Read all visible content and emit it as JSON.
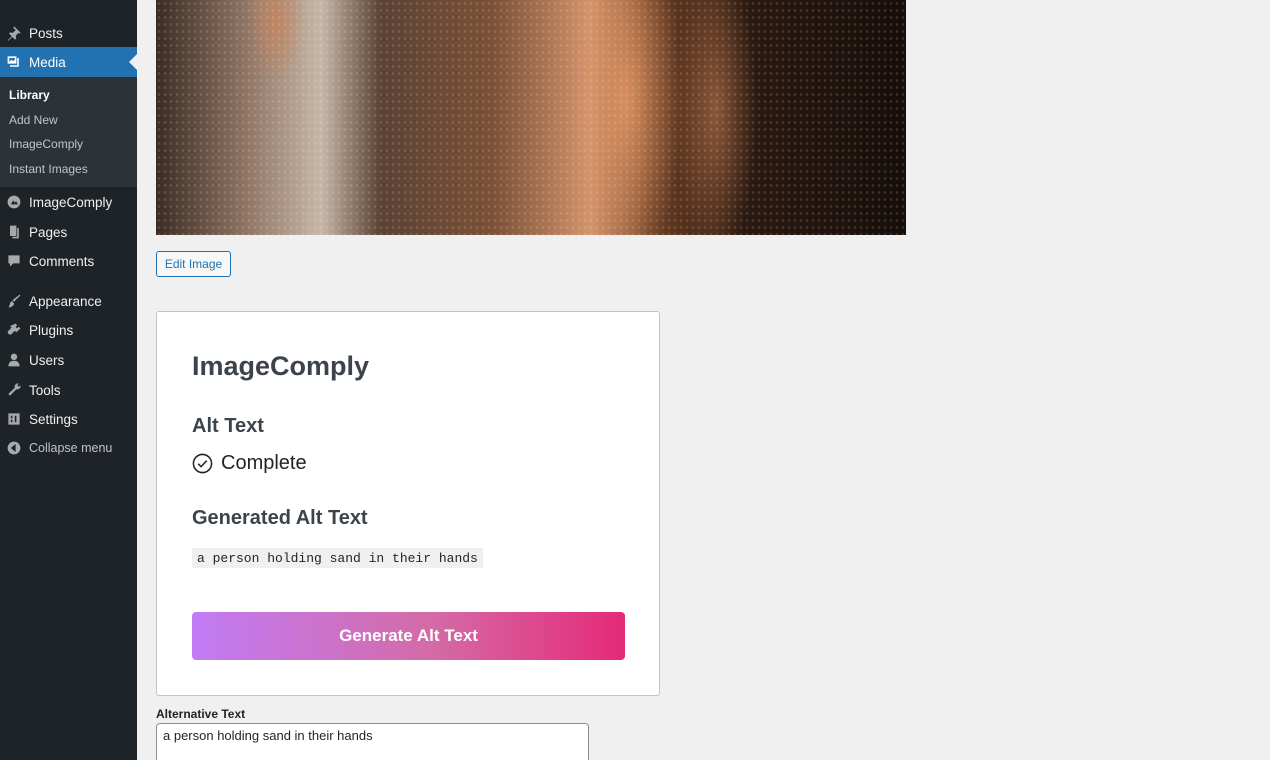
{
  "sidebar": {
    "items": [
      {
        "name": "posts",
        "label": "Posts",
        "icon": "pushpin-icon"
      },
      {
        "name": "media",
        "label": "Media",
        "icon": "media-icon",
        "active": true
      },
      {
        "name": "imagecomply",
        "label": "ImageComply",
        "icon": "imagecomply-icon"
      },
      {
        "name": "pages",
        "label": "Pages",
        "icon": "pages-icon"
      },
      {
        "name": "comments",
        "label": "Comments",
        "icon": "comment-icon"
      },
      {
        "name": "appearance",
        "label": "Appearance",
        "icon": "paintbrush-icon"
      },
      {
        "name": "plugins",
        "label": "Plugins",
        "icon": "plugin-icon"
      },
      {
        "name": "users",
        "label": "Users",
        "icon": "users-icon"
      },
      {
        "name": "tools",
        "label": "Tools",
        "icon": "wrench-icon"
      },
      {
        "name": "settings",
        "label": "Settings",
        "icon": "settings-icon"
      }
    ],
    "submenu": [
      "Library",
      "Add New",
      "ImageComply",
      "Instant Images"
    ],
    "collapse_label": "Collapse menu"
  },
  "main": {
    "edit_image_label": "Edit Image",
    "card": {
      "title": "ImageComply",
      "alt_text_heading": "Alt Text",
      "status": "Complete",
      "generated_heading": "Generated Alt Text",
      "generated_value": "a person holding sand in their hands",
      "generate_button": "Generate Alt Text"
    },
    "alternative_text_label": "Alternative Text",
    "alternative_text_value": "a person holding sand in their hands"
  },
  "colors": {
    "sidebar_bg": "#1d2327",
    "active_blue": "#2271b1",
    "gradient_start": "#c17bf5",
    "gradient_end": "#e52a78"
  }
}
